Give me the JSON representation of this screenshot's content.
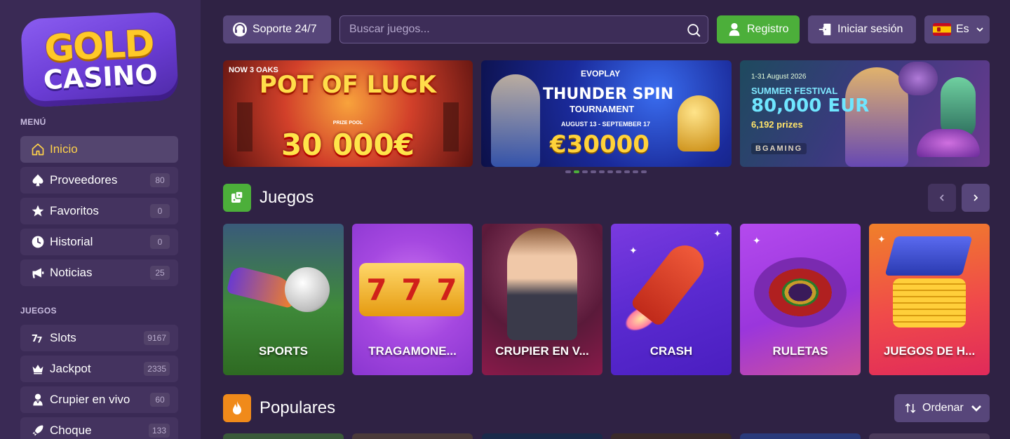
{
  "logo": {
    "line1": "GOLD",
    "line2": "CASINO"
  },
  "sidebar": {
    "menu_title": "MENÚ",
    "menu_items": [
      {
        "label": "Inicio",
        "icon": "home-icon",
        "active": true
      },
      {
        "label": "Proveedores",
        "icon": "spade-icon",
        "count": "80"
      },
      {
        "label": "Favoritos",
        "icon": "star-icon",
        "count": "0"
      },
      {
        "label": "Historial",
        "icon": "clock-icon",
        "count": "0"
      },
      {
        "label": "Noticias",
        "icon": "megaphone-icon",
        "count": "25"
      }
    ],
    "games_title": "JUEGOS",
    "game_items": [
      {
        "label": "Slots",
        "icon": "slots-icon",
        "count": "9167"
      },
      {
        "label": "Jackpot",
        "icon": "crown-icon",
        "count": "2335"
      },
      {
        "label": "Crupier en vivo",
        "icon": "dealer-icon",
        "count": "60"
      },
      {
        "label": "Choque",
        "icon": "rocket-icon",
        "count": "133"
      }
    ]
  },
  "header": {
    "support_label": "Soporte 24/7",
    "search_placeholder": "Buscar juegos...",
    "register_label": "Registro",
    "login_label": "Iniciar sesión",
    "language": "Es"
  },
  "banners": [
    {
      "provider": "NOW 3 OAKS",
      "title": "POT OF LUCK",
      "subtitle": "PRIZE POOL",
      "prize": "30 000€"
    },
    {
      "provider": "EVOPLAY",
      "title": "THUNDER SPIN",
      "subtitle": "TOURNAMENT",
      "dates": "AUGUST 13 - SEPTEMBER 17",
      "prize": "€30000"
    },
    {
      "dates": "1-31 August 2026",
      "title": "SUMMER FESTIVAL",
      "prize": "80,000 EUR",
      "subtitle": "6,192 prizes",
      "provider": "BGAMING"
    }
  ],
  "carousel": {
    "slides": 10,
    "active_index": 1
  },
  "games_section": {
    "title": "Juegos"
  },
  "categories": [
    {
      "label": "SPORTS"
    },
    {
      "label": "TRAGAMONE..."
    },
    {
      "label": "CRUPIER EN V..."
    },
    {
      "label": "CRASH"
    },
    {
      "label": "RULETAS"
    },
    {
      "label": "JUEGOS DE H..."
    }
  ],
  "popular_section": {
    "title": "Populares",
    "sort_label": "Ordenar"
  },
  "colors": {
    "accent_green": "#4caf3a",
    "active_yellow": "#ffd24a",
    "bg": "#2f2244",
    "sidebar_bg": "#3a2a55"
  }
}
